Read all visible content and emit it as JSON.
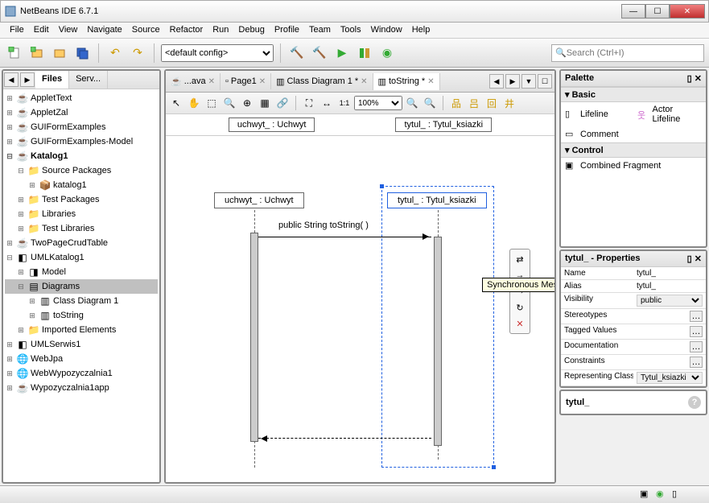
{
  "window": {
    "title": "NetBeans IDE 6.7.1"
  },
  "menu": [
    "File",
    "Edit",
    "View",
    "Navigate",
    "Source",
    "Refactor",
    "Run",
    "Debug",
    "Profile",
    "Team",
    "Tools",
    "Window",
    "Help"
  ],
  "toolbar": {
    "config": "<default config>",
    "search_placeholder": "Search (Ctrl+I)"
  },
  "sidebar": {
    "tabs": [
      "Files",
      "Serv..."
    ],
    "tree": [
      {
        "exp": "+",
        "icon": "coffee",
        "label": "AppletText",
        "indent": 0
      },
      {
        "exp": "+",
        "icon": "coffee",
        "label": "AppletZal",
        "indent": 0
      },
      {
        "exp": "+",
        "icon": "coffee",
        "label": "GUIFormExamples",
        "indent": 0
      },
      {
        "exp": "+",
        "icon": "coffee",
        "label": "GUIFormExamples-Model",
        "indent": 0
      },
      {
        "exp": "-",
        "icon": "coffee",
        "label": "Katalog1",
        "indent": 0,
        "bold": true
      },
      {
        "exp": "-",
        "icon": "folder",
        "label": "Source Packages",
        "indent": 1
      },
      {
        "exp": "+",
        "icon": "pkg",
        "label": "katalog1",
        "indent": 2
      },
      {
        "exp": "+",
        "icon": "folder",
        "label": "Test Packages",
        "indent": 1
      },
      {
        "exp": "+",
        "icon": "folder",
        "label": "Libraries",
        "indent": 1
      },
      {
        "exp": "+",
        "icon": "folder",
        "label": "Test Libraries",
        "indent": 1
      },
      {
        "exp": "+",
        "icon": "coffee",
        "label": "TwoPageCrudTable",
        "indent": 0
      },
      {
        "exp": "-",
        "icon": "uml",
        "label": "UMLKatalog1",
        "indent": 0
      },
      {
        "exp": "+",
        "icon": "model",
        "label": "Model",
        "indent": 1
      },
      {
        "exp": "-",
        "icon": "diagrams",
        "label": "Diagrams",
        "indent": 1,
        "sel": true
      },
      {
        "exp": "+",
        "icon": "diagram",
        "label": "Class Diagram 1",
        "indent": 2
      },
      {
        "exp": "+",
        "icon": "diagram",
        "label": "toString",
        "indent": 2
      },
      {
        "exp": "+",
        "icon": "folder",
        "label": "Imported Elements",
        "indent": 1
      },
      {
        "exp": "+",
        "icon": "uml",
        "label": "UMLSerwis1",
        "indent": 0
      },
      {
        "exp": "+",
        "icon": "web",
        "label": "WebJpa",
        "indent": 0
      },
      {
        "exp": "+",
        "icon": "web",
        "label": "WebWypozyczalnia1",
        "indent": 0
      },
      {
        "exp": "+",
        "icon": "coffee",
        "label": "Wypozyczalnia1app",
        "indent": 0
      }
    ]
  },
  "editor": {
    "tabs": [
      {
        "label": "...ava",
        "icon": "java",
        "x": true
      },
      {
        "label": "Page1",
        "icon": "page",
        "x": true
      },
      {
        "label": "Class Diagram 1 *",
        "icon": "diagram",
        "x": true
      },
      {
        "label": "toString *",
        "icon": "diagram",
        "x": true,
        "active": true
      }
    ],
    "zoom": "100%",
    "header_left": "uchwyt_ : Uchwyt",
    "header_right": "tytul_ : Tytul_ksiazki",
    "lifeline_left": "uchwyt_ : Uchwyt",
    "lifeline_right": "tytul_ : Tytul_ksiazki",
    "message": "public String  toString( )",
    "tooltip": "Synchronous Message"
  },
  "palette": {
    "title": "Palette",
    "sections": {
      "basic": {
        "title": "Basic",
        "items": [
          {
            "label": "Lifeline",
            "icon": "lifeline"
          },
          {
            "label": "Actor Lifeline",
            "icon": "actor"
          },
          {
            "label": "Comment",
            "icon": "comment"
          }
        ]
      },
      "control": {
        "title": "Control",
        "items": [
          {
            "label": "Combined Fragment",
            "icon": "fragment"
          }
        ]
      }
    }
  },
  "properties": {
    "title": "tytul_ - Properties",
    "rows": [
      {
        "name": "Name",
        "value": "tytul_"
      },
      {
        "name": "Alias",
        "value": "tytul_"
      },
      {
        "name": "Visibility",
        "value": "public",
        "select": true
      },
      {
        "name": "Stereotypes",
        "value": "",
        "btn": true
      },
      {
        "name": "Tagged Values",
        "value": "",
        "btn": true
      },
      {
        "name": "Documentation",
        "value": "",
        "btn": true
      },
      {
        "name": "Constraints",
        "value": "",
        "btn": true
      },
      {
        "name": "Representing Class",
        "value": "Tytul_ksiazki",
        "select": true
      }
    ]
  },
  "info": {
    "label": "tytul_"
  }
}
